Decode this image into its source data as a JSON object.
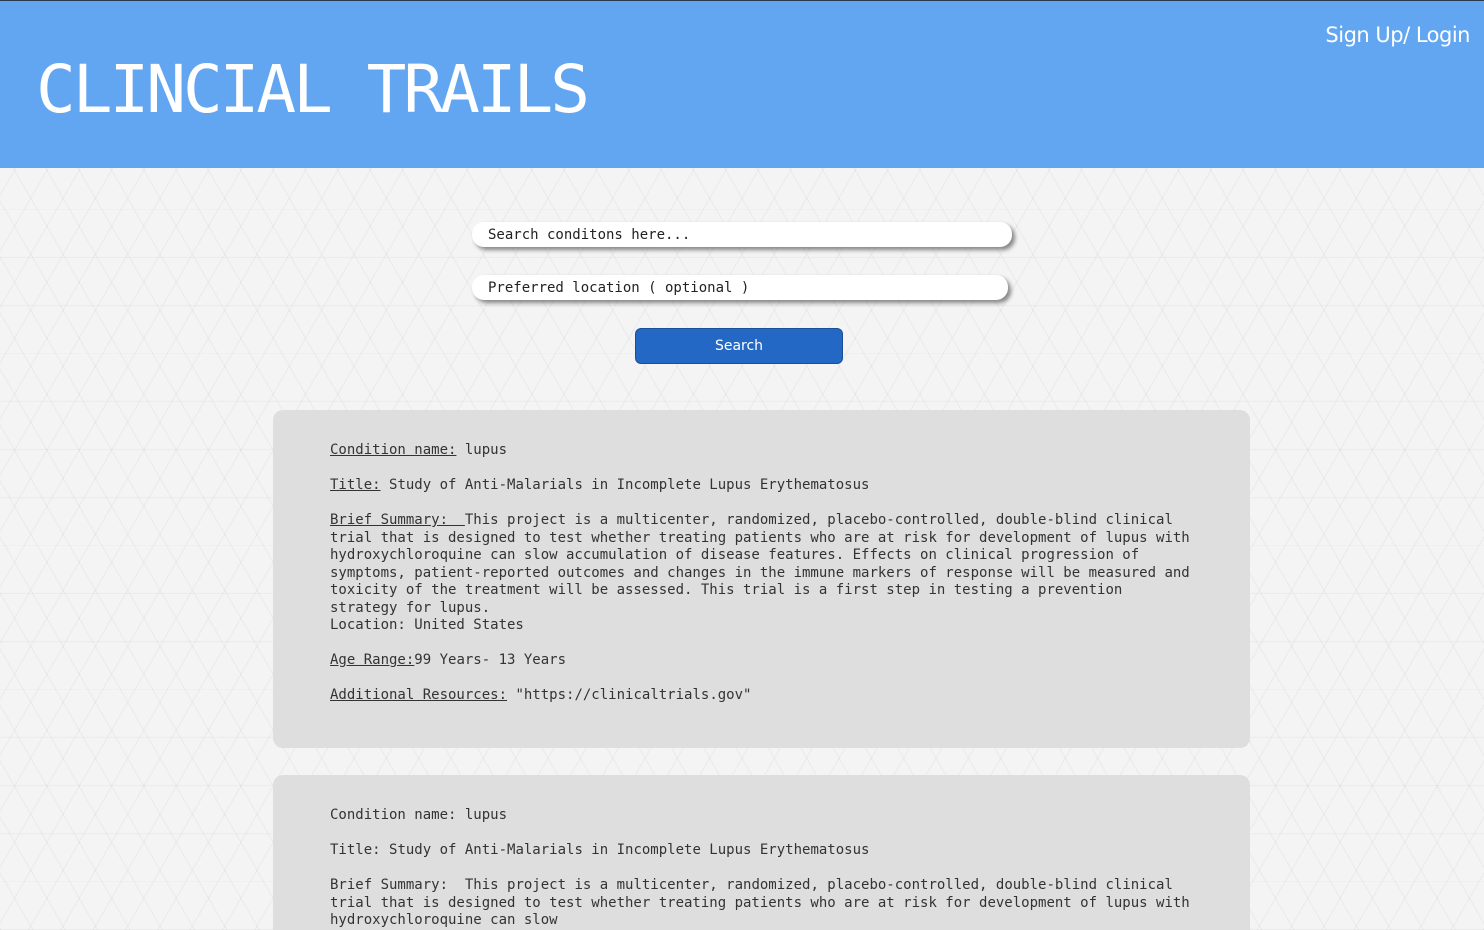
{
  "header": {
    "title": "CLINCIAL TRAILS",
    "auth_link": "Sign Up/ Login"
  },
  "search": {
    "conditions_placeholder": "Search conditons here...",
    "location_placeholder": "Preferred location ( optional )",
    "button_label": "Search"
  },
  "results": [
    {
      "condition_label": "Condition name:",
      "condition": "lupus",
      "title_label": "Title:",
      "title": "Study of Anti-Malarials in Incomplete Lupus Erythematosus",
      "summary_label": "Brief Summary:",
      "summary": "This project is a multicenter, randomized, placebo-controlled, double-blind clinical trial that is designed to test whether treating patients who are at risk for development of lupus with hydroxychloroquine can slow accumulation of disease features. Effects on clinical progression of symptoms, patient-reported outcomes and changes in the immune markers of response will be measured and toxicity of the treatment will be assessed. This trial is a first step in testing a prevention strategy for lupus.",
      "location": "Location: United States",
      "age_label": "Age Range:",
      "age": "99 Years- 13 Years",
      "resources_label": "Additional Resources:",
      "resources": "\"https://clinicaltrials.gov\""
    },
    {
      "condition_label": "Condition name:",
      "condition": "lupus",
      "title_label": "Title:",
      "title": "Study of Anti-Malarials in Incomplete Lupus Erythematosus",
      "summary_label": "Brief Summary:",
      "summary": "This project is a multicenter, randomized, placebo-controlled, double-blind clinical trial that is designed to test whether treating patients who are at risk for development of lupus with hydroxychloroquine can slow"
    }
  ]
}
